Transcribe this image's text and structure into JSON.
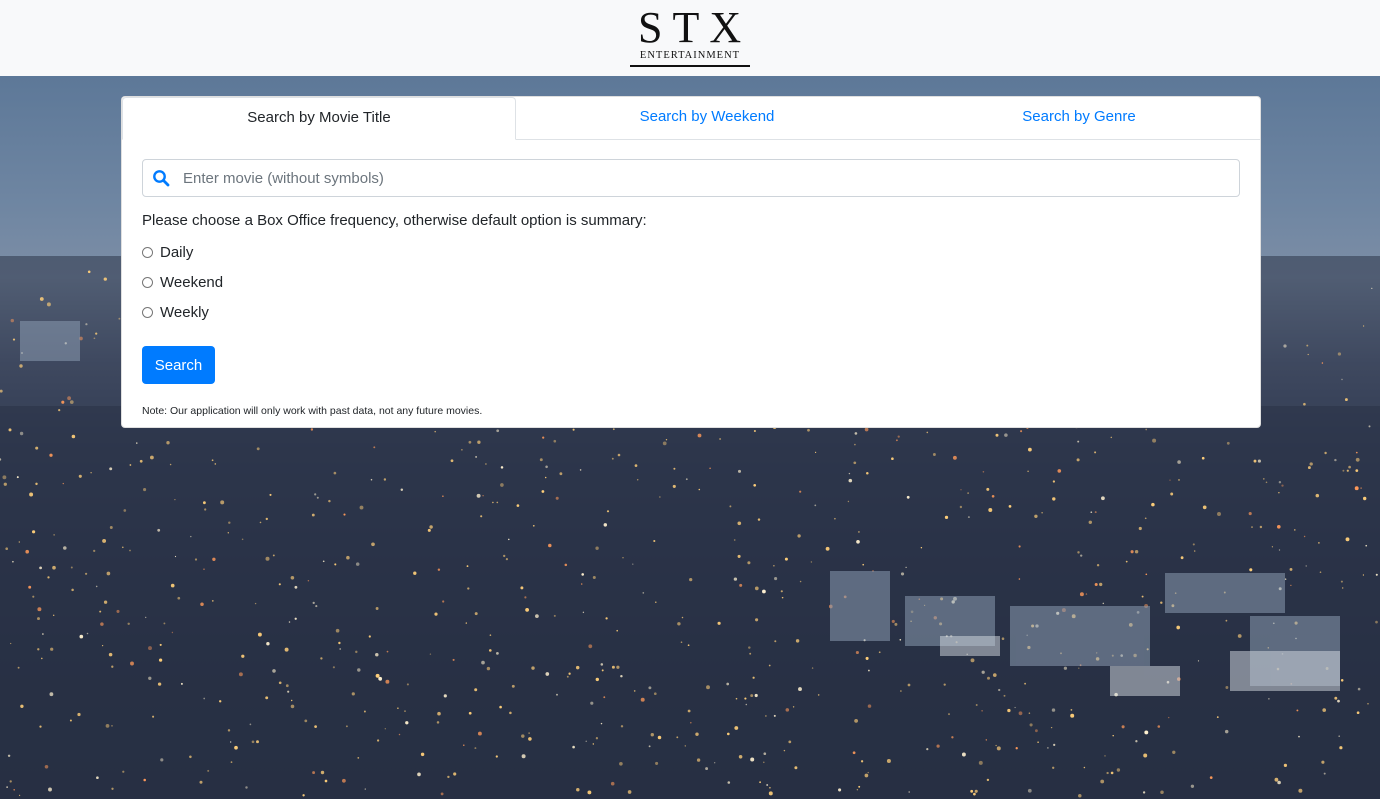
{
  "header": {
    "logo_main": "STX",
    "logo_sub": "ENTERTAINMENT"
  },
  "tabs": [
    {
      "label": "Search by Movie Title",
      "active": true
    },
    {
      "label": "Search by Weekend",
      "active": false
    },
    {
      "label": "Search by Genre",
      "active": false
    }
  ],
  "search": {
    "placeholder": "Enter movie (without symbols)",
    "value": "",
    "icon": "search-icon"
  },
  "frequency": {
    "prompt": "Please choose a Box Office frequency, otherwise default option is summary:",
    "options": [
      {
        "label": "Daily",
        "checked": false
      },
      {
        "label": "Weekend",
        "checked": false
      },
      {
        "label": "Weekly",
        "checked": false
      }
    ]
  },
  "actions": {
    "search_label": "Search"
  },
  "note": "Note: Our application will only work with past data, not any future movies.",
  "colors": {
    "accent": "#007bff",
    "header_bg": "#f8f9fa"
  }
}
